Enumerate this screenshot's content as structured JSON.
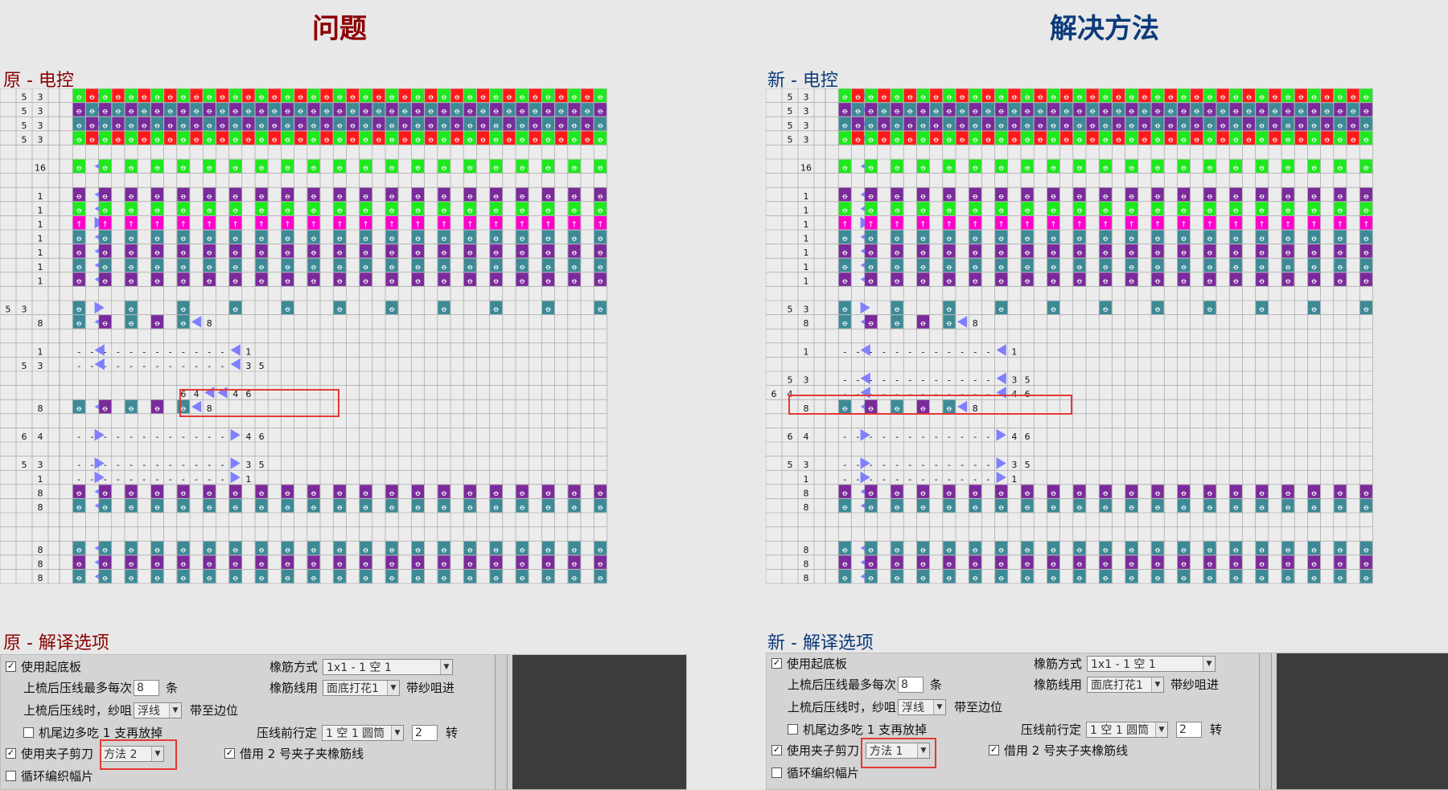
{
  "titles": {
    "problem": "问题",
    "solution": "解决方法"
  },
  "left": {
    "grid_title": "原 - 电控",
    "opts_title": "原 - 解译选项"
  },
  "right": {
    "grid_title": "新 - 电控",
    "opts_title": "新 - 解译选项"
  },
  "colors": {
    "title": "#8b0000",
    "title_right": "#0d3b7a",
    "green": "#1ee81e",
    "red": "#ff1a1a",
    "purple": "#7a2a9a",
    "teal": "#3d8a96",
    "magenta": "#ff00cc",
    "arrow": "#7f7fff",
    "highlight": "#e53935"
  },
  "rows_left": [
    [
      "",
      "5",
      "3",
      "grr"
    ],
    [
      "",
      "5",
      "3",
      "pat"
    ],
    [
      "",
      "5",
      "3",
      "ltp"
    ],
    [
      "",
      "5",
      "3",
      "grr"
    ],
    [],
    [
      "",
      "",
      "16",
      "gs"
    ],
    [],
    [
      "",
      "",
      "1",
      "ps"
    ],
    [
      "",
      "",
      "1",
      "gs"
    ],
    [
      "",
      "",
      "1",
      "ms"
    ],
    [
      "",
      "",
      "1",
      "ts"
    ],
    [
      "",
      "",
      "1",
      "ps"
    ],
    [
      "",
      "",
      "1",
      "ts"
    ],
    [
      "",
      "",
      "1",
      "ps"
    ],
    [],
    [
      "5",
      "3",
      "",
      "tsp"
    ],
    [
      "",
      "",
      "8",
      "mix8"
    ],
    [],
    [
      "",
      "",
      "1",
      "dash",
      "1",
      ""
    ],
    [
      "",
      "5",
      "3",
      "dash",
      "3",
      "5"
    ],
    [],
    [
      "",
      "",
      "",
      "hl64"
    ],
    [
      "",
      "",
      "8",
      "mix8b"
    ],
    [],
    [
      "",
      "6",
      "4",
      "dashr",
      "4",
      "6"
    ],
    [],
    [
      "",
      "5",
      "3",
      "dashr",
      "3",
      "5"
    ],
    [
      "",
      "",
      "1",
      "dashr",
      "1",
      ""
    ],
    [
      "",
      "",
      "8",
      "ps"
    ],
    [
      "",
      "",
      "8",
      "ts"
    ],
    [],
    [],
    [
      "",
      "",
      "8",
      "ts"
    ],
    [
      "",
      "",
      "8",
      "ps"
    ],
    [
      "",
      "",
      "8",
      "ts"
    ]
  ],
  "rows_right": [
    [
      "",
      "5",
      "3",
      "grr"
    ],
    [
      "",
      "5",
      "3",
      "pat"
    ],
    [
      "",
      "5",
      "3",
      "ltp"
    ],
    [
      "",
      "5",
      "3",
      "grr"
    ],
    [],
    [
      "",
      "",
      "16",
      "gs"
    ],
    [],
    [
      "",
      "",
      "1",
      "ps"
    ],
    [
      "",
      "",
      "1",
      "gs"
    ],
    [
      "",
      "",
      "1",
      "ms"
    ],
    [
      "",
      "",
      "1",
      "ts"
    ],
    [
      "",
      "",
      "1",
      "ps"
    ],
    [
      "",
      "",
      "1",
      "ts"
    ],
    [
      "",
      "",
      "1",
      "ps"
    ],
    [],
    [
      "",
      "5",
      "3",
      "tsp"
    ],
    [
      "",
      "",
      "8",
      "mix8"
    ],
    [],
    [
      "",
      "",
      "1",
      "dash",
      "1",
      ""
    ],
    [],
    [
      "",
      "5",
      "3",
      "dash",
      "3",
      "5"
    ],
    [
      "6",
      "4",
      "",
      "dash",
      "4",
      "6"
    ],
    [
      "",
      "",
      "8",
      "mix8b"
    ],
    [],
    [
      "",
      "6",
      "4",
      "dashr",
      "4",
      "6"
    ],
    [],
    [
      "",
      "5",
      "3",
      "dashr",
      "3",
      "5"
    ],
    [
      "",
      "",
      "1",
      "dashr",
      "1",
      ""
    ],
    [
      "",
      "",
      "8",
      "ps"
    ],
    [
      "",
      "",
      "8",
      "ts"
    ],
    [],
    [],
    [
      "",
      "",
      "8",
      "ts"
    ],
    [
      "",
      "",
      "8",
      "ps"
    ],
    [
      "",
      "",
      "8",
      "ts"
    ]
  ],
  "opts_left": {
    "use_board": "使用起底板",
    "max_label": "上梳后压线最多每次",
    "max_value": "8",
    "max_unit": "条",
    "yarn_label": "上梳后压线时，纱咀",
    "yarn_value": "浮线",
    "to_edge": "带至边位",
    "tail_label": "机尾边多吃 1 支再放掉",
    "use_clip": "使用夹子剪刀",
    "clip_method": "方法 2",
    "loop": "循环编织幅片",
    "rib_mode_label": "橡筋方式",
    "rib_mode_value": "1x1 - 1 空 1",
    "rib_yarn_label": "橡筋线用",
    "rib_yarn_value": "面底打花1",
    "rib_yarn_suffix": "带纱咀进",
    "pre_label": "压线前行定",
    "pre_value": "1 空 1 圆筒",
    "pre_count": "2",
    "pre_unit": "转",
    "borrow": "借用 2 号夹子夹橡筋线"
  },
  "opts_right": {
    "use_board": "使用起底板",
    "max_label": "上梳后压线最多每次",
    "max_value": "8",
    "max_unit": "条",
    "yarn_label": "上梳后压线时，纱咀",
    "yarn_value": "浮线",
    "to_edge": "带至边位",
    "tail_label": "机尾边多吃 1 支再放掉",
    "use_clip": "使用夹子剪刀",
    "clip_method": "方法 1",
    "loop": "循环编织幅片",
    "rib_mode_label": "橡筋方式",
    "rib_mode_value": "1x1 - 1 空 1",
    "rib_yarn_label": "橡筋线用",
    "rib_yarn_value": "面底打花1",
    "rib_yarn_suffix": "带纱咀进",
    "pre_label": "压线前行定",
    "pre_value": "1 空 1 圆筒",
    "pre_count": "2",
    "pre_unit": "转",
    "borrow": "借用 2 号夹子夹橡筋线"
  }
}
